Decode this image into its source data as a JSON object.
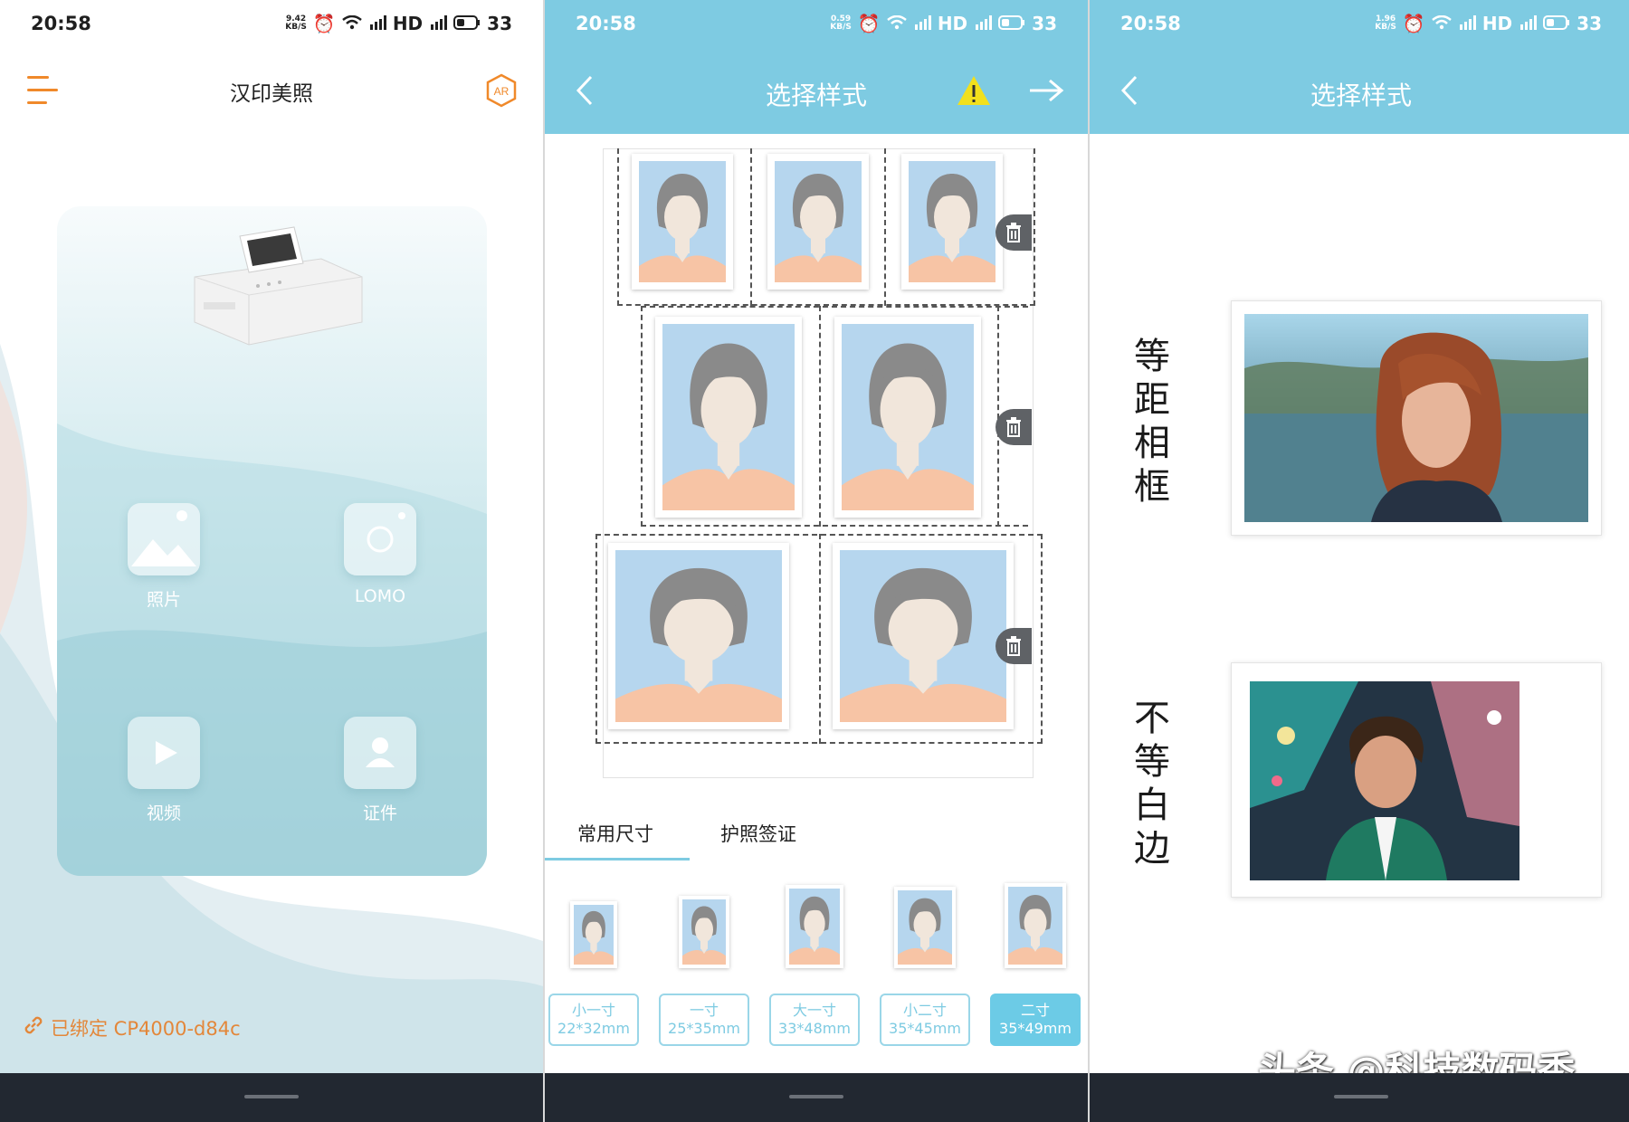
{
  "screen1": {
    "status": {
      "time": "20:58",
      "speed_top": "9.42",
      "speed_bottom": "KB/S",
      "hd": "HD",
      "battery": "33"
    },
    "app_title": "汉印美照",
    "functions": [
      {
        "label": "照片",
        "icon": "photo-icon"
      },
      {
        "label": "LOMO",
        "icon": "camera-icon"
      },
      {
        "label": "视频",
        "icon": "video-icon"
      },
      {
        "label": "证件",
        "icon": "id-person-icon"
      }
    ],
    "bound_device": "已绑定 CP4000-d84c",
    "ar_label": "AR",
    "colors": {
      "accent": "#f0892a",
      "card": "#a6d3dc"
    }
  },
  "screen2": {
    "status": {
      "time": "20:58",
      "speed_top": "0.59",
      "speed_bottom": "KB/S",
      "hd": "HD",
      "battery": "33"
    },
    "title": "选择样式",
    "tabs": [
      "常用尺寸",
      "护照签证"
    ],
    "active_tab": "常用尺寸",
    "sizes": [
      {
        "name": "小一寸",
        "dims": "22*32mm"
      },
      {
        "name": "一寸",
        "dims": "25*35mm"
      },
      {
        "name": "大一寸",
        "dims": "33*48mm"
      },
      {
        "name": "小二寸",
        "dims": "35*45mm"
      },
      {
        "name": "二寸",
        "dims": "35*49mm"
      }
    ],
    "selected_size": "二寸",
    "colors": {
      "header": "#7ecbe2",
      "photo_bg": "#b6d6ee"
    }
  },
  "screen3": {
    "status": {
      "time": "20:58",
      "speed_top": "1.96",
      "speed_bottom": "KB/S",
      "hd": "HD",
      "battery": "33"
    },
    "title": "选择样式",
    "options": [
      {
        "label": "等距相框"
      },
      {
        "label": "不等白边"
      }
    ],
    "watermark": "头条 @科技数码秀"
  }
}
